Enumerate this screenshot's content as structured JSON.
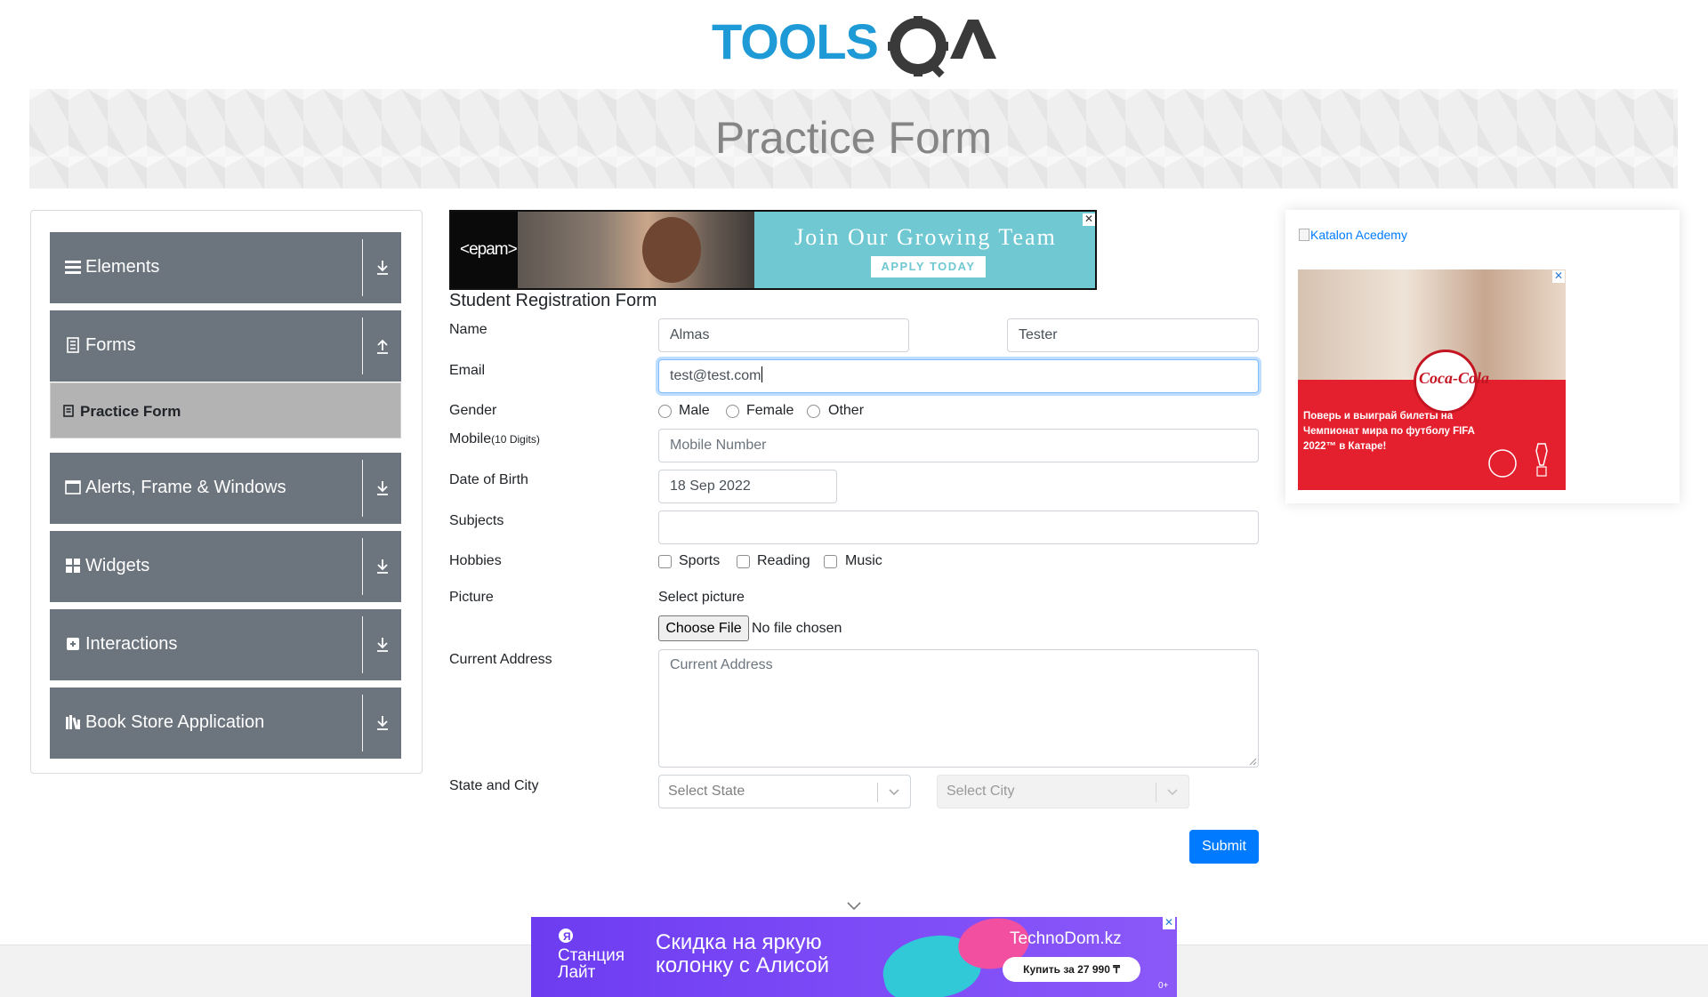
{
  "header": {
    "logo_text": "TOOLSQA",
    "page_title": "Practice Form"
  },
  "sidebar": {
    "groups": [
      {
        "label": "Elements",
        "icon": "list-icon",
        "arrow": "download-arrow-icon"
      },
      {
        "label": "Forms",
        "icon": "document-icon",
        "arrow": "upload-arrow-icon"
      },
      {
        "label": "Alerts, Frame & Windows",
        "icon": "window-icon",
        "arrow": "download-arrow-icon"
      },
      {
        "label": "Widgets",
        "icon": "widgets-icon",
        "arrow": "download-arrow-icon"
      },
      {
        "label": "Interactions",
        "icon": "interactions-icon",
        "arrow": "download-arrow-icon"
      },
      {
        "label": "Book Store Application",
        "icon": "books-icon",
        "arrow": "download-arrow-icon"
      }
    ],
    "active_item": "Practice Form"
  },
  "ads": {
    "top": {
      "brand": "<epam>",
      "headline": "Join Our Growing Team",
      "cta": "APPLY TODAY"
    },
    "right": {
      "image_alt": "Katalon Acedemy",
      "brand": "Coca-Cola",
      "text": "Поверь и выиграй билеты на Чемпионат мира по футболу FIFA 2022™ в Катаре!"
    },
    "bottom": {
      "brand": "Станция Лайт",
      "headline": "Скидка на яркую колонку с Алисой",
      "store": "TechnoDom.kz",
      "cta": "Купить за 27 990 ₸",
      "age": "0+"
    }
  },
  "form": {
    "title": "Student Registration Form",
    "name": {
      "label": "Name",
      "first": "Almas",
      "last": "Tester"
    },
    "email": {
      "label": "Email",
      "value": "test@test.com"
    },
    "gender": {
      "label": "Gender",
      "options": [
        "Male",
        "Female",
        "Other"
      ]
    },
    "mobile": {
      "label": "Mobile",
      "hint": "(10 Digits)",
      "placeholder": "Mobile Number"
    },
    "dob": {
      "label": "Date of Birth",
      "value": "18 Sep 2022"
    },
    "subjects": {
      "label": "Subjects",
      "value": ""
    },
    "hobbies": {
      "label": "Hobbies",
      "options": [
        "Sports",
        "Reading",
        "Music"
      ]
    },
    "picture": {
      "label": "Picture",
      "caption": "Select picture",
      "button": "Choose File",
      "status": "No file chosen"
    },
    "address": {
      "label": "Current Address",
      "placeholder": "Current Address"
    },
    "state_city": {
      "label": "State and City",
      "state_placeholder": "Select State",
      "city_placeholder": "Select City"
    },
    "submit": "Submit"
  },
  "colors": {
    "sidebar_bg": "#6c757d",
    "active_item_bg": "#b3b3b3",
    "primary": "#007bff",
    "logo_blue": "#1e9ad6",
    "logo_dark": "#3a3a3a"
  }
}
